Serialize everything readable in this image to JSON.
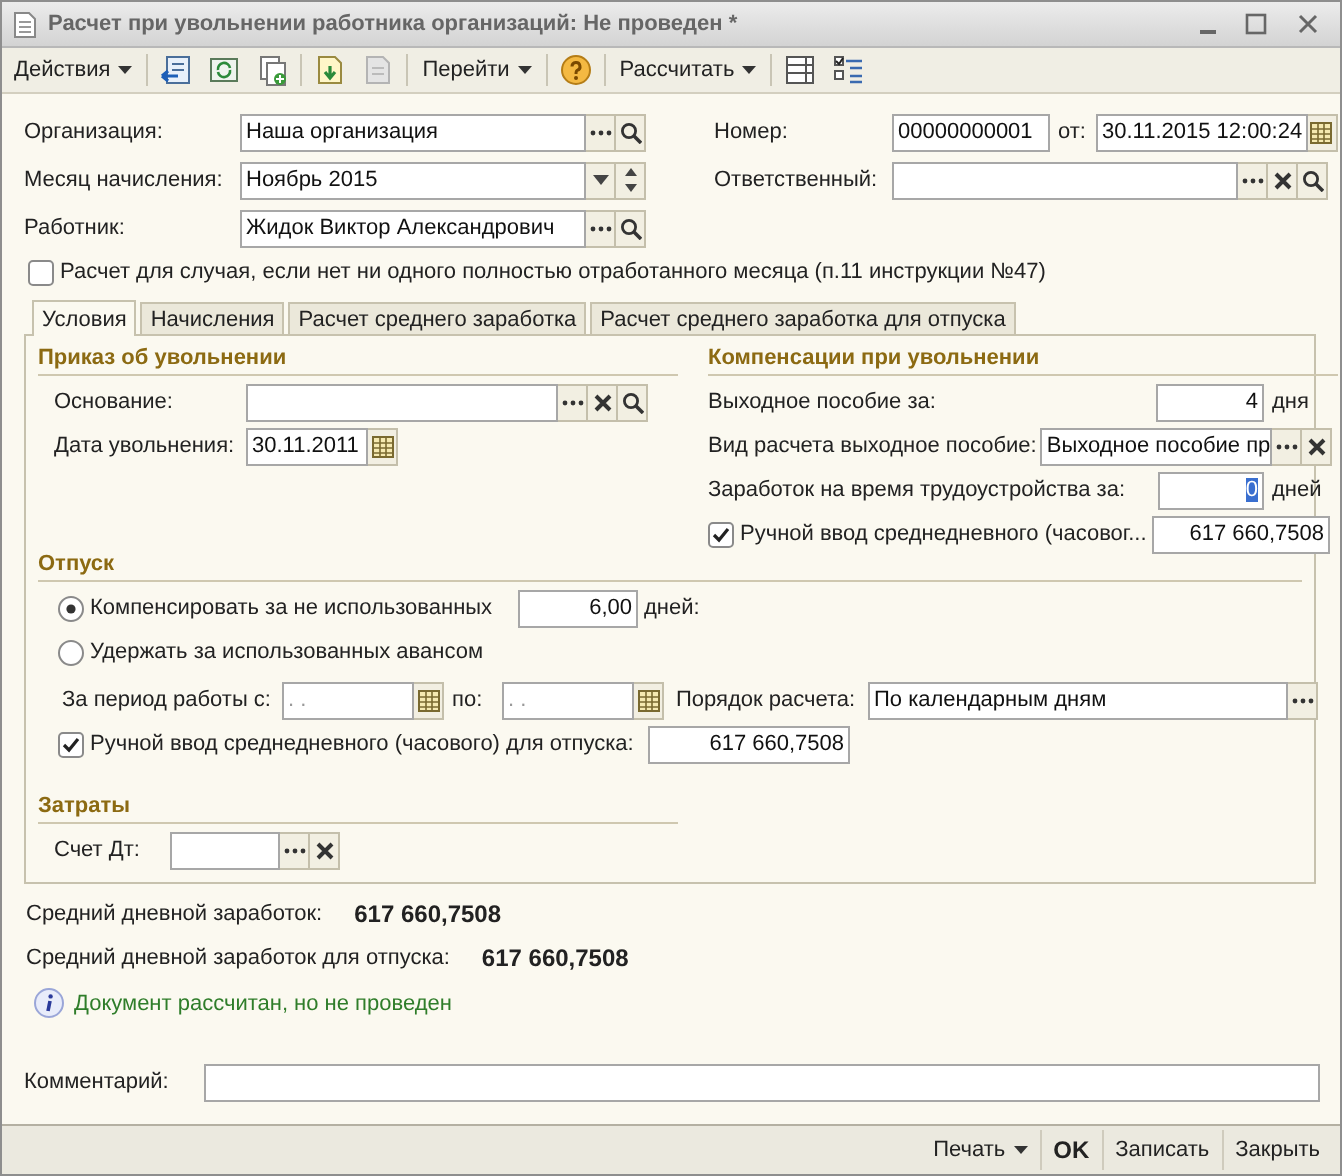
{
  "window": {
    "title": "Расчет при увольнении работника организаций: Не проведен *"
  },
  "toolbar": {
    "menus": [
      {
        "label": "Действия"
      },
      {
        "label": "Перейти"
      },
      {
        "label": "Рассчитать"
      }
    ]
  },
  "header": {
    "organization": {
      "label": "Организация:",
      "value": "Наша организация"
    },
    "month": {
      "label": "Месяц начисления:",
      "value": "Ноябрь 2015"
    },
    "employee": {
      "label": "Работник:",
      "value": "Жидок Виктор Александрович"
    },
    "number": {
      "label": "Номер:",
      "value": "00000000001"
    },
    "date": {
      "label": "от:",
      "value": "30.11.2015 12:00:24"
    },
    "responsible": {
      "label": "Ответственный:"
    },
    "no_full_month": {
      "label": "Расчет для случая, если нет ни одного полностью отработанного месяца (п.11 инструкции №47)",
      "checked": false
    }
  },
  "tabs": [
    {
      "label": "Условия",
      "selected": true
    },
    {
      "label": "Начисления",
      "selected": false
    },
    {
      "label": "Расчет среднего заработка",
      "selected": false
    },
    {
      "label": "Расчет среднего заработка для отпуска",
      "selected": false
    }
  ],
  "dismissal_order": {
    "title": "Приказ об увольнении",
    "basis": {
      "label": "Основание:"
    },
    "dismissal_date": {
      "label": "Дата увольнения:",
      "value": "30.11.2011"
    }
  },
  "compensation": {
    "title": "Компенсации при увольнении",
    "severance": {
      "label": "Выходное пособие за:",
      "value": "4",
      "unit": "дня"
    },
    "severance_type": {
      "label": "Вид расчета выходное пособие:",
      "value": "Выходное пособие пр"
    },
    "job_search_pay": {
      "label": "Заработок на время трудоустройства за:",
      "value": "0",
      "unit": "дней"
    },
    "manual_average": {
      "label": "Ручной ввод среднедневного (часовог...",
      "checked": true,
      "value": "617 660,7508"
    }
  },
  "vacation": {
    "title": "Отпуск",
    "options": [
      {
        "label": "Компенсировать за не использованных",
        "selected": true
      },
      {
        "label": "Удержать за использованных авансом",
        "selected": false
      }
    ],
    "days": {
      "value": "6,00",
      "unit": "дней:"
    },
    "period": {
      "label": "За период работы с:",
      "from": {
        "placeholder": ". ."
      },
      "to_label": "по:",
      "to": {
        "placeholder": ". ."
      }
    },
    "calc_order": {
      "label": "Порядок расчета:",
      "value": "По календарным дням"
    },
    "manual_average": {
      "label": "Ручной ввод среднедневного (часового) для отпуска:",
      "checked": true,
      "value": "617 660,7508"
    }
  },
  "costs": {
    "title": "Затраты",
    "debit_account": {
      "label": "Счет Дт:"
    }
  },
  "summary": [
    {
      "label": "Средний дневной заработок:",
      "value": "617 660,7508"
    },
    {
      "label": "Средний дневной заработок для отпуска:",
      "value": "617 660,7508"
    }
  ],
  "info": {
    "text": "Документ рассчитан, но не проведен"
  },
  "comment": {
    "label": "Комментарий:"
  },
  "footer": [
    {
      "label": "Печать",
      "kind": "menu"
    },
    {
      "label": "OK",
      "kind": "default"
    },
    {
      "label": "Записать",
      "kind": "plain"
    },
    {
      "label": "Закрыть",
      "kind": "plain"
    }
  ]
}
